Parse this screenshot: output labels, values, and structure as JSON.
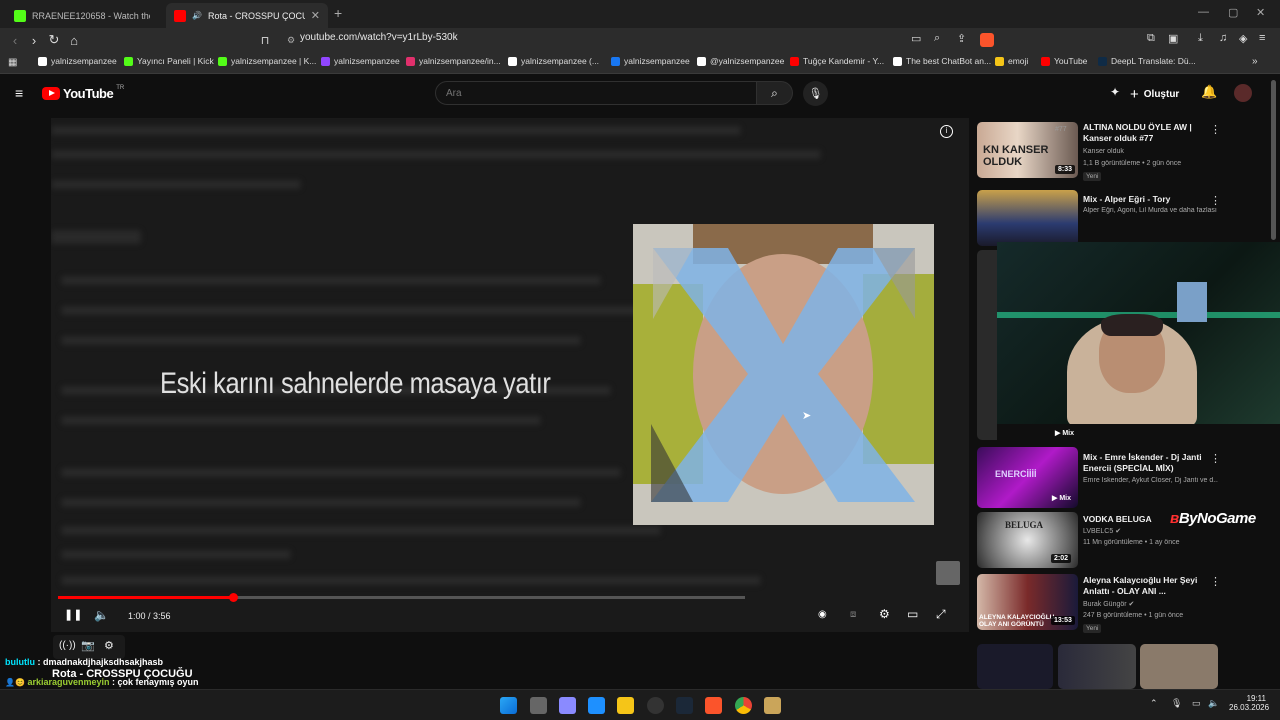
{
  "browser": {
    "tabs": [
      {
        "title": "RRAENEE120658 - Watch the VOD on",
        "active": false,
        "icon_color": "#53fc18"
      },
      {
        "title": "Rota - CROSSPU ÇOCUĞU - Y",
        "active": true,
        "icon_color": "#ff0000"
      }
    ],
    "new_tab_label": "+",
    "url": "youtube.com/watch?v=y1rLby-530k",
    "window_controls": [
      "—",
      "▢",
      "✕"
    ],
    "bookmarks": [
      {
        "label": "yalnizsempanzee",
        "icon_color": "#ffffff"
      },
      {
        "label": "Yayıncı Paneli | Kick",
        "icon_color": "#53fc18"
      },
      {
        "label": "yalnizsempanzee | K...",
        "icon_color": "#53fc18"
      },
      {
        "label": "yalnizsempanzee",
        "icon_color": "#9146ff"
      },
      {
        "label": "yalnizsempanzee/in...",
        "icon_color": "#e1306c"
      },
      {
        "label": "yalnizsempanzee (...",
        "icon_color": "#ffffff"
      },
      {
        "label": "yalnizsempanzee",
        "icon_color": "#1877f2"
      },
      {
        "label": "@yalnizsempanzee",
        "icon_color": "#ffffff"
      },
      {
        "label": "Tuğçe Kandemir - Y...",
        "icon_color": "#ff0000"
      },
      {
        "label": "The best ChatBot an...",
        "icon_color": "#ffffff"
      },
      {
        "label": "emoji",
        "icon_color": "#f5c518"
      },
      {
        "label": "YouTube",
        "icon_color": "#ff0000"
      },
      {
        "label": "DeepL Translate: Dü...",
        "icon_color": "#0f2b46"
      }
    ]
  },
  "youtube": {
    "logo_text": "YouTube",
    "region": "TR",
    "search_placeholder": "Ara",
    "create_label": "Oluştur"
  },
  "player": {
    "lyric": "Eski karını sahnelerde masaya yatır",
    "current_time": "1:00",
    "duration": "3:56",
    "progress_fraction": 0.255,
    "time_display": "1:00 / 3:56"
  },
  "recommendations": [
    {
      "title": "ALTINA NOLDU ÖYLE AW | Kanser olduk #77",
      "channel": "Kanser olduk",
      "meta": "1,1 B görüntüleme • 2 gün önce",
      "badge": "Yeni",
      "duration": "8:33",
      "thumb_label": "KN KANSER OLDUK",
      "thumb_num": "#77"
    },
    {
      "title": "Mix - Alper Eğri - Tory",
      "channel": "Alper Eğri, Agoni, Lil Murda ve daha fazlası",
      "meta": "",
      "badge": "",
      "duration": "",
      "thumb_label": ""
    },
    {
      "title": "",
      "channel": "",
      "meta": "",
      "badge": "",
      "duration": "Mix",
      "thumb_label": ""
    },
    {
      "title": "Mix - Emre İskender - Dj Janti Enercii (SPECİAL MİX)",
      "channel": "Emre İskender, Aykut Closer, Dj Janti ve d...",
      "meta": "",
      "badge": "",
      "duration": "Mix",
      "thumb_label": "ENERCİİİİ"
    },
    {
      "title": "VODKA BELUGA",
      "channel": "LVBELC5",
      "meta": "11 Mn görüntüleme • 1 ay önce",
      "badge": "",
      "duration": "2:02",
      "thumb_label": "BELUGA"
    },
    {
      "title": "Aleyna Kalaycıoğlu Her Şeyi Anlattı - OLAY ANI ...",
      "channel": "Burak Güngör",
      "meta": "247 B görüntüleme • 1 gün önce",
      "badge": "Yeni",
      "duration": "13:53",
      "thumb_label": "ALEYNA KALAYCIOĞLU OLAY ANI GÖRÜNTÜ"
    }
  ],
  "overlay": {
    "watermark": "ByNoGame",
    "now_playing": "Rota - CROSSPU ÇOCUĞU",
    "chat": [
      {
        "user": "bulutlu",
        "message": "dmadnakdjhajksdhsakjhasb",
        "color": "#00e5ff"
      },
      {
        "user": "arkiaraguvenmeyin",
        "message": "çok fenaymış oyun",
        "color": "#9acd32"
      }
    ]
  },
  "taskbar": {
    "time": "19:11",
    "date": "26.03.2026"
  }
}
